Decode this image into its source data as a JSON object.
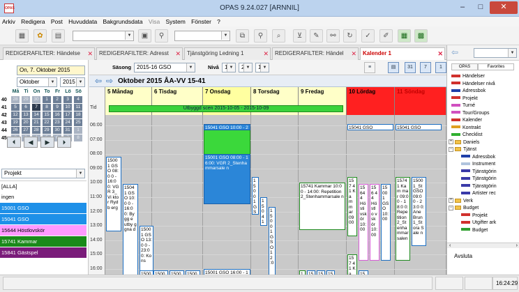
{
  "app": {
    "logo_text": "OPAS",
    "title": "OPAS 9.24.027  [ARNNIL]",
    "win_min": "–",
    "win_max": "□",
    "win_close": "✕"
  },
  "menu": {
    "items": [
      "Arkiv",
      "Redigera",
      "Post",
      "Huvuddata",
      "Bakgrundsdata",
      "Visa",
      "System",
      "Fönster",
      "?"
    ]
  },
  "tabs": [
    {
      "label": "REDIGERAFILTER: Händelse",
      "active": false
    },
    {
      "label": "REDIGERAFILTER: Adresst",
      "active": false
    },
    {
      "label": "Tjänstgöring Ledning 1",
      "active": false
    },
    {
      "label": "REDIGERAFILTER: Händel",
      "active": false
    },
    {
      "label": "Kalender 1",
      "active": true
    }
  ],
  "tab_close": "✕",
  "left": {
    "date_field": "On, 7. Oktober 2015",
    "month": "Oktober",
    "year": "2015",
    "weekday_headers": [
      "Må",
      "Ti",
      "On",
      "To",
      "Fr",
      "Lö",
      "Sö"
    ],
    "weeks": [
      {
        "wk": "40",
        "days": [
          "28",
          "29",
          "30",
          "1",
          "2",
          "3",
          "4"
        ],
        "dim": [
          true,
          true,
          true,
          false,
          false,
          false,
          false
        ]
      },
      {
        "wk": "41",
        "days": [
          "5",
          "6",
          "7",
          "8",
          "9",
          "10",
          "11"
        ],
        "dim": [
          false,
          false,
          false,
          false,
          false,
          false,
          false
        ],
        "sel": 2
      },
      {
        "wk": "42",
        "days": [
          "12",
          "13",
          "14",
          "15",
          "16",
          "17",
          "18"
        ],
        "dim": [
          false,
          false,
          false,
          false,
          false,
          false,
          false
        ]
      },
      {
        "wk": "43",
        "days": [
          "19",
          "20",
          "21",
          "22",
          "23",
          "24",
          "25"
        ],
        "dim": [
          false,
          false,
          false,
          false,
          false,
          false,
          false
        ]
      },
      {
        "wk": "44",
        "days": [
          "26",
          "27",
          "28",
          "29",
          "30",
          "31",
          "1"
        ],
        "dim": [
          false,
          false,
          false,
          false,
          false,
          false,
          true
        ]
      },
      {
        "wk": "45",
        "days": [
          "2",
          "3",
          "4",
          "5",
          "6",
          "7",
          "8"
        ],
        "dim": [
          true,
          true,
          true,
          true,
          true,
          true,
          true
        ]
      }
    ],
    "nav": [
      "⏴",
      "◀",
      "▶",
      "⏵"
    ],
    "filter_label": "Projekt",
    "list": [
      {
        "label": "[ALLA]",
        "bg": "#ffffff",
        "fg": "#000000"
      },
      {
        "label": "ingen",
        "bg": "#ffffff",
        "fg": "#000000"
      },
      {
        "label": "15001 GSO",
        "bg": "#1e90e8",
        "fg": "#ffffff"
      },
      {
        "label": "15041 GSO",
        "bg": "#1e90e8",
        "fg": "#ffffff"
      },
      {
        "label": "15644 Höstlovskör",
        "bg": "#ff99ff",
        "fg": "#000000"
      },
      {
        "label": "15741 Kammar",
        "bg": "#1a8a1a",
        "fg": "#ffffff"
      },
      {
        "label": "15841 Gästspel",
        "bg": "#7a1c7a",
        "fg": "#ffffff"
      }
    ]
  },
  "calendar": {
    "season_label": "Säsong",
    "season": "2015-16 GSO",
    "level_label": "Nivå",
    "level_values": [
      "1",
      "2",
      "1"
    ],
    "week_title": "Oktober 2015 ÅA-VV 15-41",
    "days": [
      {
        "label": "5 Måndag",
        "bg": "#ffffc8",
        "fg": "#000000"
      },
      {
        "label": "6 Tisdag",
        "bg": "#ffffc8",
        "fg": "#000000"
      },
      {
        "label": "7 Onsdag",
        "bg": "#ffffa0",
        "fg": "#000000"
      },
      {
        "label": "8 Torsdag",
        "bg": "#ffffc8",
        "fg": "#000000"
      },
      {
        "label": "9 Fredag",
        "bg": "#ffffc8",
        "fg": "#000000"
      },
      {
        "label": "10 Lördag",
        "bg": "#ff2020",
        "fg": "#000000"
      },
      {
        "label": "11 Söndag",
        "bg": "#ff2020",
        "fg": "#c00000"
      }
    ],
    "tid_label": "Tid",
    "times": [
      "06:00",
      "07:00",
      "08:00",
      "09:00",
      "10:00",
      "11:00",
      "12:00",
      "13:00",
      "14:00",
      "15:00",
      "16:00"
    ],
    "banner": "Utbyggd scen 2015-10-05 - 2015-10-09",
    "events": {
      "mon_a": "1500 1 GSO 08:0 0 - 16:0 0: VGR 3_Vi ktor Rydb erg",
      "mon_b": "1504 1 GSO 10:0 0 - 16:0 0: Bygg e utby ggna d",
      "mon_c": "1500 1 GSO 13:0 0 - 23:0 0: Kons",
      "mon_d": "1500 1_St",
      "wed_top": "15041 GSO 10:00 - 23:00",
      "wed_main": "15001 GSO 08:00 - 16:00: VGR 2_Stenhammarsale n",
      "wed_bottom": "15001 GSO 16:00 - 18:00:",
      "tue_a": "1500",
      "tue_b": "1500",
      "tue_c": "1500",
      "thu_a": "15 00 1 G S O 09 :3",
      "thu_b": "15 04 1 G S O 11 :0",
      "thu_c": "15 00 1 G S O 12 :0",
      "fri_a": "15741 Kammar 10:00 - 14:00: Repetition 2_Stenhammarsale n",
      "fri_b": "15 74",
      "fri_c": "15",
      "fri_d": "15",
      "fri_e": "15",
      "sat_top": "15041 GSO",
      "sat_a": "157 41 Ka mm ar 09 00",
      "sat_b": "15 64 4 Hö sti vsk ör 10: 00",
      "sat_c": "156 44 Hö stlo vsk ör 10: 00",
      "sat_d": "15 00 1 GS O 10: 00",
      "sat_e": "157 41 Ka mm",
      "sat_f": "15 00",
      "sun_top": "15041 GSO",
      "sun_a": "1574 1 Kam mar 09:0 0 - 18:0 0: Repe tition 2_St enha mmar salen",
      "sun_b": "1500 1_St GSO 09:0 0 - 23:0 0: Ane Brun 1_St ora Sale n"
    }
  },
  "right": {
    "tabs": [
      "OPAS",
      "Favorites"
    ],
    "tree": [
      {
        "label": "Händelser",
        "type": "sw",
        "color": "#d0312d",
        "indent": 6
      },
      {
        "label": "Händelser nivå",
        "type": "sw",
        "color": "#d0312d",
        "indent": 6
      },
      {
        "label": "Adressbok",
        "type": "sw",
        "color": "#1f3fa8",
        "indent": 6
      },
      {
        "label": "Projekt",
        "type": "sw",
        "color": "#d0312d",
        "indent": 6
      },
      {
        "label": "Turné",
        "type": "sw",
        "color": "#d050c0",
        "indent": 6
      },
      {
        "label": "Tour/Groups",
        "type": "sw",
        "color": "#d050c0",
        "indent": 6
      },
      {
        "label": "Kalender",
        "type": "sw",
        "color": "#d0312d",
        "indent": 6
      },
      {
        "label": "Kontrakt",
        "type": "sw",
        "color": "#e0a020",
        "indent": 6
      },
      {
        "label": "Checklist",
        "type": "sw",
        "color": "#30b030",
        "indent": 6
      },
      {
        "label": "Daniels",
        "type": "folder",
        "pm": "+",
        "indent": 2
      },
      {
        "label": "Tjänst",
        "type": "folder",
        "pm": "−",
        "indent": 2
      },
      {
        "label": "Adressbok",
        "type": "sw",
        "color": "#1f3fa8",
        "indent": 20
      },
      {
        "label": "Instrument",
        "type": "sw",
        "color": "#b0c4de",
        "indent": 20
      },
      {
        "label": "Tjänstgörin",
        "type": "sw",
        "color": "#3a3aa8",
        "indent": 20
      },
      {
        "label": "Tjänstgörin",
        "type": "sw",
        "color": "#3a3aa8",
        "indent": 20
      },
      {
        "label": "Tjänstgörin",
        "type": "sw",
        "color": "#3a3aa8",
        "indent": 20
      },
      {
        "label": "Artister rec",
        "type": "sw",
        "color": "#3a3aa8",
        "indent": 20
      },
      {
        "label": "Verk",
        "type": "folder",
        "pm": "+",
        "indent": 2
      },
      {
        "label": "Budget",
        "type": "folder",
        "pm": "−",
        "indent": 2
      },
      {
        "label": "Projekt",
        "type": "sw",
        "color": "#d0312d",
        "indent": 20
      },
      {
        "label": "Utgifter ark",
        "type": "sw",
        "color": "#d0312d",
        "indent": 20
      },
      {
        "label": "Budget",
        "type": "sw",
        "color": "#30a030",
        "indent": 20
      }
    ],
    "avsluta": "Avsluta"
  },
  "status": {
    "time": "16:24:29"
  }
}
